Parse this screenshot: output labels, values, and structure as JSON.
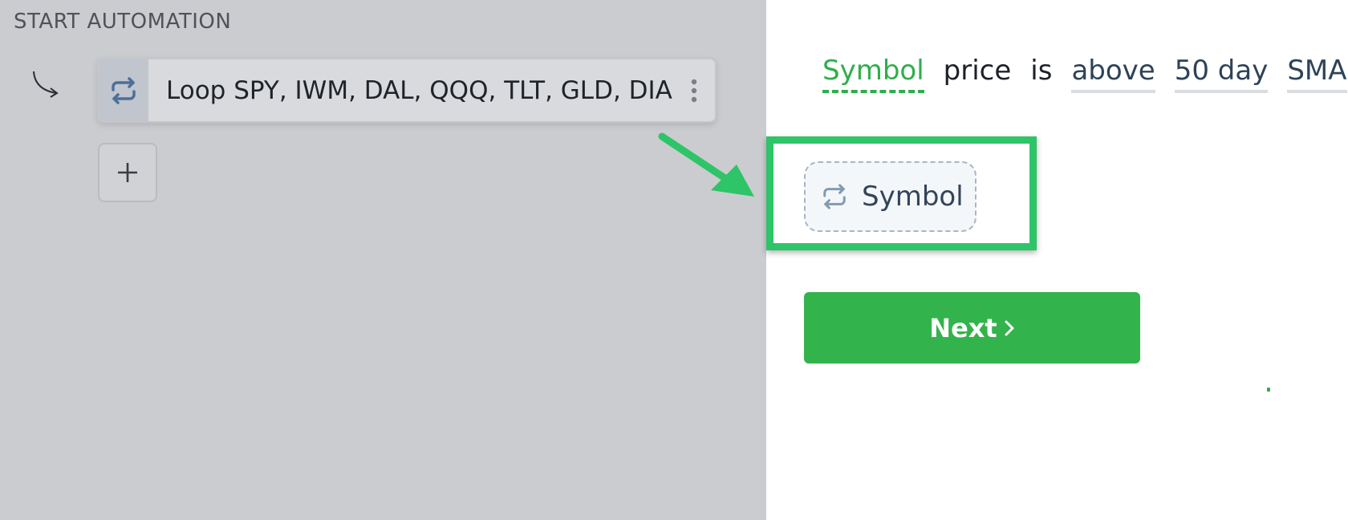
{
  "left_panel": {
    "section_label": "START AUTOMATION",
    "loop_card": {
      "label": "Loop SPY, IWM, DAL, QQQ, TLT, GLD, DIA",
      "icon": "repeat-icon",
      "menu_icon": "kebab-menu-icon"
    },
    "add_button": {
      "label": "+"
    }
  },
  "right_panel": {
    "sentence": [
      {
        "text": "Symbol",
        "kind": "active"
      },
      {
        "text": "price",
        "kind": "static"
      },
      {
        "text": "is",
        "kind": "static"
      },
      {
        "text": "above",
        "kind": "field"
      },
      {
        "text": "50 day",
        "kind": "field"
      },
      {
        "text": "SMA",
        "kind": "field"
      }
    ],
    "symbol_chip": {
      "label": "Symbol",
      "icon": "repeat-icon"
    },
    "next_button": {
      "label": "Next",
      "icon": "chevron-right-icon"
    }
  },
  "colors": {
    "accent_green": "#2fae4b",
    "highlight_green": "#2ec468",
    "button_green": "#33b34c",
    "dim_overlay": "#cbccd0"
  }
}
